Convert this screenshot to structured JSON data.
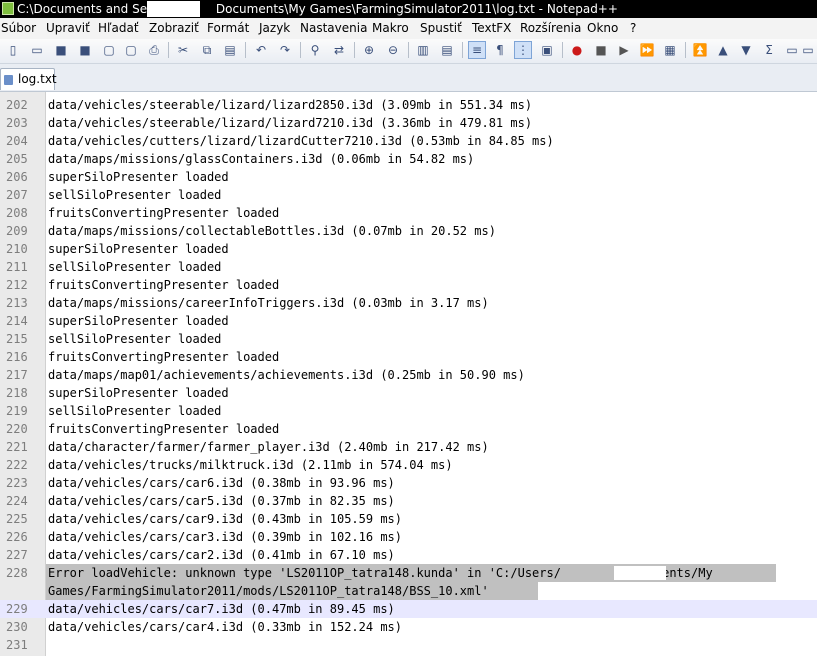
{
  "window": {
    "title": "C:\\Documents and Settings\\        Documents\\My Games\\FarmingSimulator2011\\log.txt - Notepad++"
  },
  "menubar": {
    "items": [
      "Súbor",
      "Upraviť",
      "Hľadať",
      "Zobraziť",
      "Formát",
      "Jazyk",
      "Nastavenia",
      "Makro",
      "Spustiť",
      "TextFX",
      "Rozšírenia",
      "Okno",
      "?"
    ]
  },
  "toolbar": {
    "icons": [
      "new-file-icon",
      "open-file-icon",
      "save-icon",
      "save-all-icon",
      "close-icon",
      "close-all-icon",
      "print-icon",
      "cut-icon",
      "copy-icon",
      "paste-icon",
      "undo-icon",
      "redo-icon",
      "find-icon",
      "replace-icon",
      "zoom-in-icon",
      "zoom-out-icon",
      "sync-vertical-icon",
      "sync-horizontal-icon",
      "word-wrap-icon",
      "show-all-chars-icon",
      "indent-guide-icon",
      "user-language-icon",
      "record-macro-icon",
      "stop-record-icon",
      "play-macro-icon",
      "run-macro-multiple-icon",
      "save-macro-icon",
      "tfx-icon-1",
      "tfx-icon-2",
      "tfx-icon-3",
      "tfx-icon-4",
      "tfx-icon-5",
      "tfx-icon-6"
    ]
  },
  "tabs": [
    {
      "label": "log.txt"
    }
  ],
  "editor": {
    "lines": [
      {
        "n": "202",
        "text": "data/vehicles/steerable/lizard/lizard2850.i3d (3.09mb in 551.34 ms)"
      },
      {
        "n": "203",
        "text": "data/vehicles/steerable/lizard/lizard7210.i3d (3.36mb in 479.81 ms)"
      },
      {
        "n": "204",
        "text": "data/vehicles/cutters/lizard/lizardCutter7210.i3d (0.53mb in 84.85 ms)"
      },
      {
        "n": "205",
        "text": "data/maps/missions/glassContainers.i3d (0.06mb in 54.82 ms)"
      },
      {
        "n": "206",
        "text": "superSiloPresenter loaded"
      },
      {
        "n": "207",
        "text": "sellSiloPresenter loaded"
      },
      {
        "n": "208",
        "text": "fruitsConvertingPresenter loaded"
      },
      {
        "n": "209",
        "text": "data/maps/missions/collectableBottles.i3d (0.07mb in 20.52 ms)"
      },
      {
        "n": "210",
        "text": "superSiloPresenter loaded"
      },
      {
        "n": "211",
        "text": "sellSiloPresenter loaded"
      },
      {
        "n": "212",
        "text": "fruitsConvertingPresenter loaded"
      },
      {
        "n": "213",
        "text": "data/maps/missions/careerInfoTriggers.i3d (0.03mb in 3.17 ms)"
      },
      {
        "n": "214",
        "text": "superSiloPresenter loaded"
      },
      {
        "n": "215",
        "text": "sellSiloPresenter loaded"
      },
      {
        "n": "216",
        "text": "fruitsConvertingPresenter loaded"
      },
      {
        "n": "217",
        "text": "data/maps/map01/achievements/achievements.i3d (0.25mb in 50.90 ms)"
      },
      {
        "n": "218",
        "text": "superSiloPresenter loaded"
      },
      {
        "n": "219",
        "text": "sellSiloPresenter loaded"
      },
      {
        "n": "220",
        "text": "fruitsConvertingPresenter loaded"
      },
      {
        "n": "221",
        "text": "data/character/farmer/farmer_player.i3d (2.40mb in 217.42 ms)"
      },
      {
        "n": "222",
        "text": "data/vehicles/trucks/milktruck.i3d (2.11mb in 574.04 ms)"
      },
      {
        "n": "223",
        "text": "data/vehicles/cars/car6.i3d (0.38mb in 93.96 ms)"
      },
      {
        "n": "224",
        "text": "data/vehicles/cars/car5.i3d (0.37mb in 82.35 ms)"
      },
      {
        "n": "225",
        "text": "data/vehicles/cars/car9.i3d (0.43mb in 105.59 ms)"
      },
      {
        "n": "226",
        "text": "data/vehicles/cars/car3.i3d (0.39mb in 102.16 ms)"
      },
      {
        "n": "227",
        "text": "data/vehicles/cars/car2.i3d (0.41mb in 67.10 ms)"
      },
      {
        "n": "228",
        "text": "Error loadVehicle: unknown type 'LS2011OP_tatra148.kunda' in 'C:/Users/        /Documents/My"
      },
      {
        "n": "",
        "text": "Games/FarmingSimulator2011/mods/LS2011OP_tatra148/BSS_10.xml'"
      },
      {
        "n": "229",
        "text": "data/vehicles/cars/car7.i3d (0.47mb in 89.45 ms)"
      },
      {
        "n": "230",
        "text": "data/vehicles/cars/car4.i3d (0.33mb in 152.24 ms)"
      },
      {
        "n": "231",
        "text": ""
      }
    ]
  }
}
